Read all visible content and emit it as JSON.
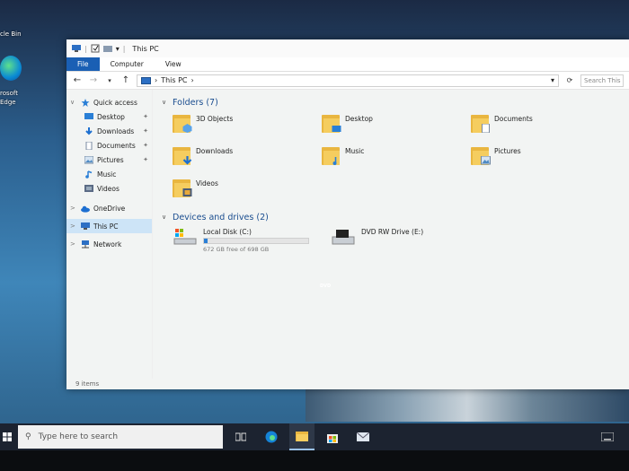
{
  "desktop": {
    "recycle_bin_label": "cle Bin",
    "edge_label_1": "rosoft",
    "edge_label_2": "Edge"
  },
  "window": {
    "title": "This PC",
    "qat_sep": "|",
    "qat_dropdown": "▾",
    "ribbon_tabs": [
      "File",
      "Computer",
      "View"
    ],
    "address_path": "This PC",
    "address_sep_1": "›",
    "address_sep_2": "›",
    "search_placeholder": "Search This PC",
    "nav_back": "←",
    "nav_forward": "→",
    "nav_recent": "▾",
    "nav_up": "↑",
    "dropdown_arrow": "▾",
    "refresh": "⟳"
  },
  "sidebar": {
    "quick_access": "Quick access",
    "pinned": [
      {
        "label": "Desktop",
        "pinned": true
      },
      {
        "label": "Downloads",
        "pinned": true
      },
      {
        "label": "Documents",
        "pinned": true
      },
      {
        "label": "Pictures",
        "pinned": true
      },
      {
        "label": "Music",
        "pinned": false
      },
      {
        "label": "Videos",
        "pinned": false
      }
    ],
    "onedrive": "OneDrive",
    "this_pc": "This PC",
    "network": "Network",
    "chevron_open": "∨",
    "chevron_closed": ">",
    "pin_glyph": "✦"
  },
  "content": {
    "folders_header": "Folders (7)",
    "folders": [
      "3D Objects",
      "Desktop",
      "Documents",
      "Downloads",
      "Music",
      "Pictures",
      "Videos"
    ],
    "drives_header": "Devices and drives (2)",
    "drives": [
      {
        "name": "Local Disk (C:)",
        "free": "672 GB free of 698 GB",
        "used_fraction": 0.037
      },
      {
        "name": "DVD RW Drive (E:)"
      }
    ],
    "dvd_label": "DVD",
    "chevron": "∨"
  },
  "status": {
    "items": "9 items"
  },
  "taskbar": {
    "search_placeholder": "Type here to search",
    "search_icon": "⚲"
  },
  "colors": {
    "accent": "#1a5fb4",
    "folder": "#f5cd5f",
    "taskbar": "#1c2330"
  }
}
